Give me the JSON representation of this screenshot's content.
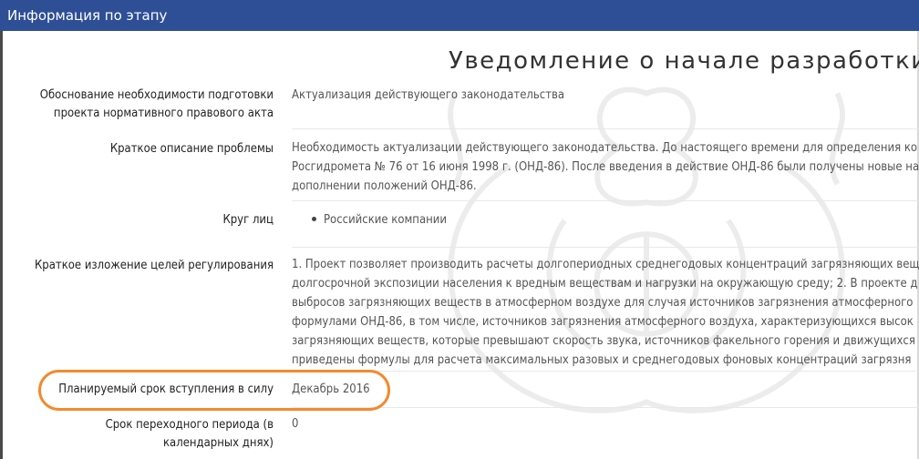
{
  "window": {
    "title": "Информация по этапу"
  },
  "page": {
    "heading": "Уведомление о начале разработки"
  },
  "rows": [
    {
      "label_lines": [
        "Обоснование необходимости подготовки",
        "проекта нормативного правового акта"
      ],
      "value_lines": [
        "Актуализация действующего законодательства"
      ]
    },
    {
      "label_lines": [
        "Краткое описание проблемы"
      ],
      "value_lines": [
        "Необходимость актуализации действующего законодательства. До настоящего времени для определения ко",
        "Росгидромета № 76 от 16 июня 1998 г. (ОНД-86). После введения в действие ОНД-86 были получены новые на",
        "дополнении положений ОНД-86."
      ]
    },
    {
      "label_lines": [
        "Круг лиц"
      ],
      "value_list": [
        "Российские компании"
      ]
    },
    {
      "label_lines": [
        "Краткое изложение целей регулирования"
      ],
      "value_lines": [
        "1. Проект позволяет производить расчеты долгопериодных среднегодовых концентраций загрязняющих вещ",
        "долгосрочной экспозиции населения к вредным веществам и нагрузки на окружающую среду; 2. В проекте д",
        "выбросов загрязняющих веществ в атмосферном воздухе для случая источников загрязнения атмосферного",
        "формулами ОНД-86, в том числе, источников загрязнения атмосферного воздуха, характеризующихся высок",
        "загрязняющих веществ, которые превышают скорость звука, источников факельного горения и движущихся",
        "приведены формулы для расчета максимальных разовых и среднегодовых фоновых концентраций загрязня"
      ]
    },
    {
      "label_lines": [
        "Планируемый срок вступления в силу"
      ],
      "value_lines": [
        "Декабрь 2016"
      ]
    },
    {
      "label_lines": [
        "Срок переходного периода (в",
        "календарных днях)"
      ],
      "value_lines": [
        "0"
      ]
    }
  ],
  "highlight_color": "#f28a2e",
  "titlebar_color": "#2e4f96"
}
